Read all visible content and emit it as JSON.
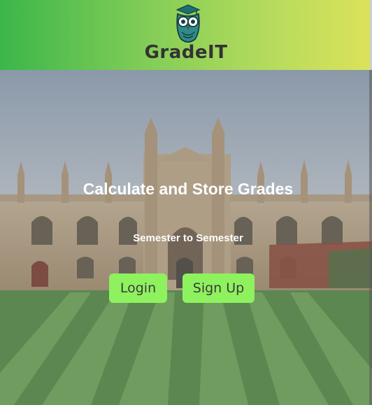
{
  "header": {
    "brand": "GradeIT",
    "logo_icon": "owl-graduation-cap-icon"
  },
  "hero": {
    "background": "university-chapel-lawn-photo",
    "headline": "Calculate and Store Grades",
    "subheadline": "Semester to Semester"
  },
  "actions": {
    "login_label": "Login",
    "signup_label": "Sign Up"
  },
  "colors": {
    "header_gradient_start": "#3cb64a",
    "header_gradient_end": "#dde25a",
    "button_bg": "#8ef25f",
    "brand_text": "#333333"
  }
}
